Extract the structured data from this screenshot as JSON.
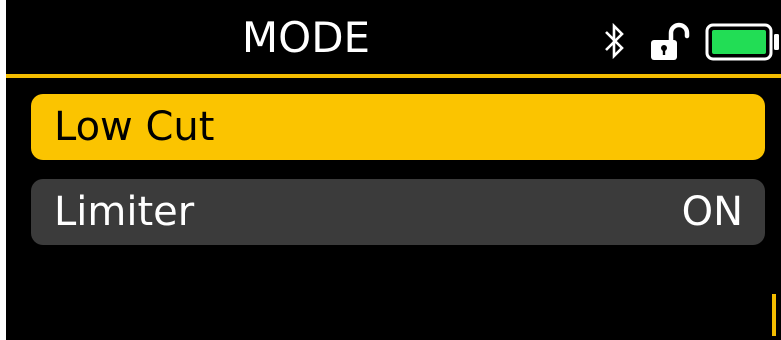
{
  "header": {
    "title": "MODE",
    "status_icons": [
      "bluetooth-icon",
      "unlocked-padlock-icon",
      "battery-icon"
    ],
    "battery_level": 1.0
  },
  "menu": {
    "items": [
      {
        "label": "Low Cut",
        "value": "",
        "selected": true
      },
      {
        "label": "Limiter",
        "value": "ON",
        "selected": false
      }
    ]
  },
  "colors": {
    "background": "#000000",
    "accent": "#fbc400",
    "item_background": "#3b3b3b",
    "battery_fill": "#22dd55",
    "text_light": "#ffffff",
    "text_dark": "#000000"
  }
}
